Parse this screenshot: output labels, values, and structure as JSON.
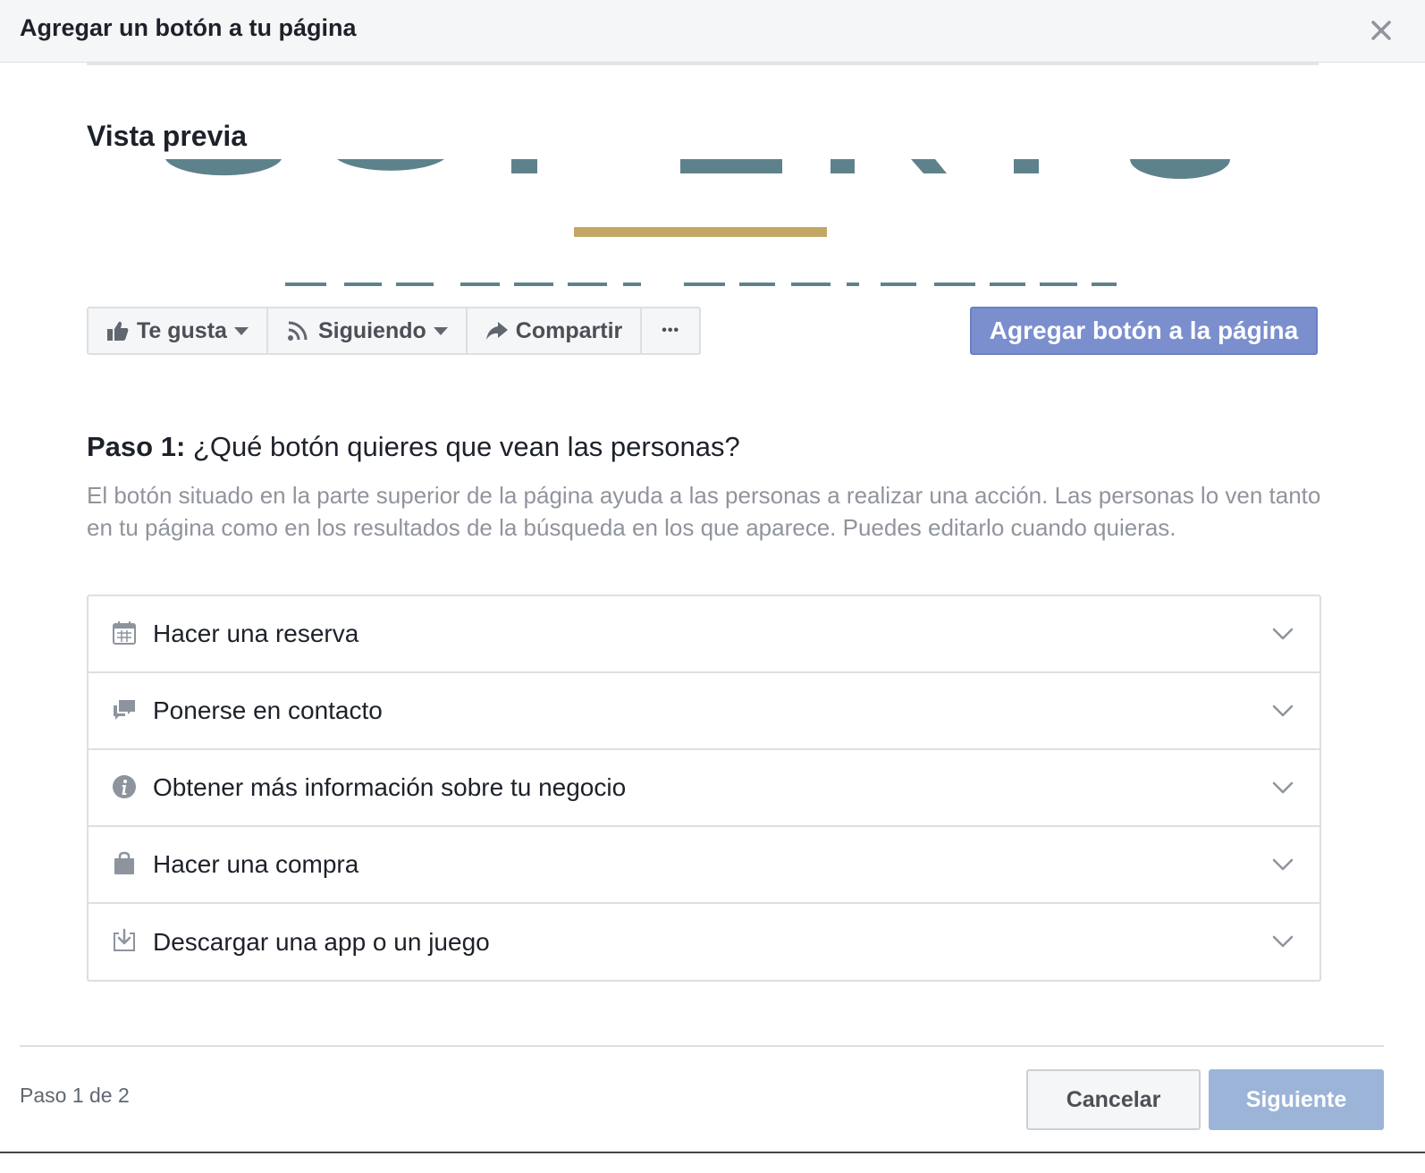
{
  "dialog": {
    "title": "Agregar un botón a tu página"
  },
  "preview": {
    "title": "Vista previa",
    "cover_colors": {
      "shapes": "#5e828b",
      "underline": "#c3a765"
    }
  },
  "page_actions": {
    "like_label": "Te gusta",
    "following_label": "Siguiendo",
    "share_label": "Compartir",
    "more_label": "•••",
    "add_button_label": "Agregar botón a la página"
  },
  "step": {
    "label": "Paso 1:",
    "question": " ¿Qué botón quieres que vean las personas?",
    "description": "El botón situado en la parte superior de la página ayuda a las personas a realizar una acción. Las personas lo ven tanto en tu página como en los resultados de la búsqueda en los que aparece. Puedes editarlo cuando quieras."
  },
  "options": [
    {
      "label": "Hacer una reserva",
      "icon": "calendar-icon"
    },
    {
      "label": "Ponerse en contacto",
      "icon": "chat-bubbles-icon"
    },
    {
      "label": "Obtener más información sobre tu negocio",
      "icon": "info-icon"
    },
    {
      "label": "Hacer una compra",
      "icon": "shopping-bag-icon"
    },
    {
      "label": "Descargar una app o un juego",
      "icon": "download-icon"
    }
  ],
  "footer": {
    "step_counter": "Paso 1 de 2",
    "cancel_label": "Cancelar",
    "next_label": "Siguiente"
  },
  "colors": {
    "primary": "#7b8fce",
    "disabled_primary": "#9cb4d8",
    "header_bg": "#f5f6f7",
    "muted_text": "#90949c"
  }
}
